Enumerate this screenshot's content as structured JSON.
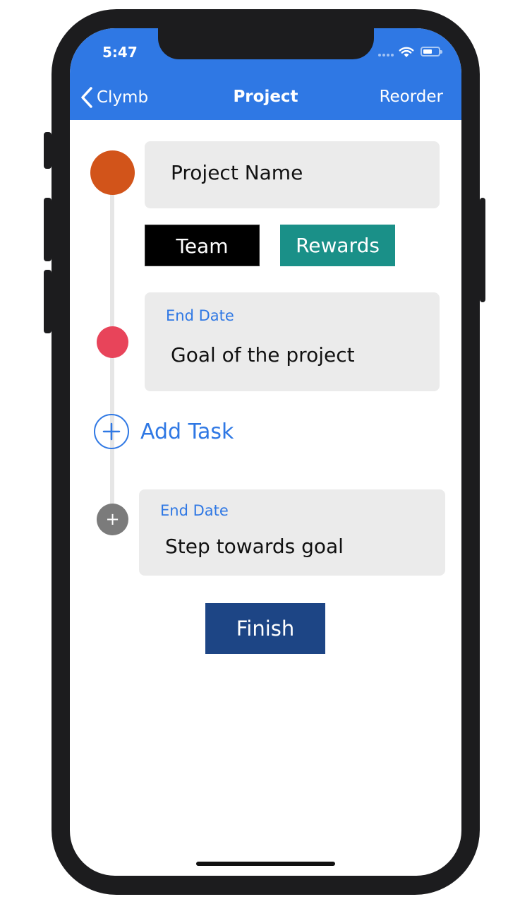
{
  "status_bar": {
    "time": "5:47"
  },
  "nav": {
    "back_label": "Clymb",
    "title": "Project",
    "reorder_label": "Reorder"
  },
  "project": {
    "name": "Project Name",
    "team_label": "Team",
    "rewards_label": "Rewards"
  },
  "goal": {
    "end_date_label": "End Date",
    "text": "Goal of the project"
  },
  "add_task_label": "Add Task",
  "step": {
    "end_date_label": "End Date",
    "text": "Step towards goal"
  },
  "finish_label": "Finish",
  "colors": {
    "nav_blue": "#2f78e4",
    "project_dot": "#d2541a",
    "goal_dot": "#e8445a",
    "step_dot": "#7b7b7b",
    "rewards": "#1a9088",
    "finish": "#1d4585"
  },
  "icons": [
    "back-chevron-icon",
    "wifi-icon",
    "battery-icon",
    "plus-circle-icon",
    "plus-icon"
  ]
}
